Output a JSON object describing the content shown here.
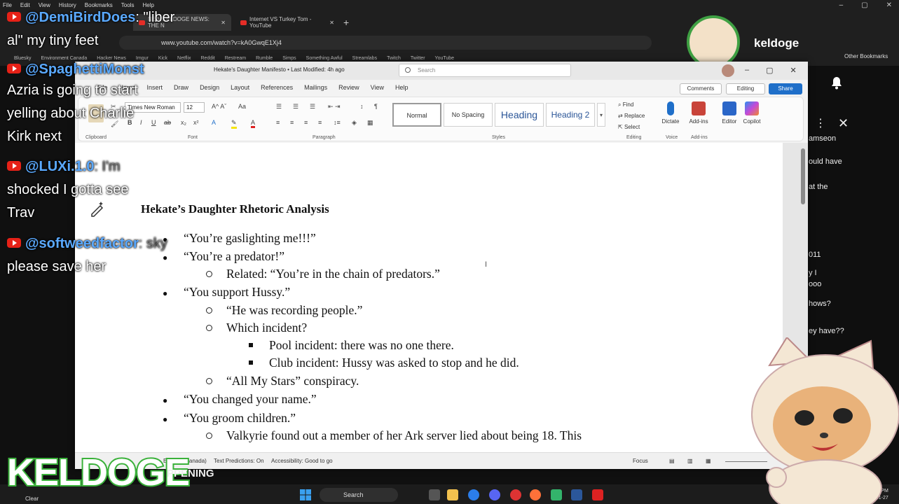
{
  "browser": {
    "menu": [
      "File",
      "Edit",
      "View",
      "History",
      "Bookmarks",
      "Tools",
      "Help"
    ],
    "tabs": [
      {
        "label": "NEW KELDOGE NEWS: THE N"
      },
      {
        "label": "Internet VS Turkey Tom - YouTube"
      }
    ],
    "new_tab": "+",
    "address": "www.youtube.com/watch?v=kA0GwqE1Xj4",
    "bookmarks": [
      "Bluesky",
      "Environment Canada",
      "Hacker News",
      "Imgur",
      "Kick",
      "Netflix",
      "Reddit",
      "Restream",
      "Rumble",
      "Simps",
      "Something Awful",
      "Streamlabs",
      "Twitch",
      "Twitter",
      "YouTube"
    ],
    "other_bookmarks": "Other Bookmarks"
  },
  "youtube": {
    "channel_name": "keldoge",
    "chat_snippets": [
      "amseon",
      "ould have",
      "at the",
      "011",
      "y I",
      "ooo",
      "hows?",
      "ey have??"
    ]
  },
  "word": {
    "doc_title": "Hekate's Daughter Manifesto • Last Modified: 4h ago",
    "search_placeholder": "Search",
    "ribbon_tabs": [
      "File",
      "Home",
      "Insert",
      "Draw",
      "Design",
      "Layout",
      "References",
      "Mailings",
      "Review",
      "View",
      "Help"
    ],
    "comments": "Comments",
    "editing": "Editing",
    "share": "Share",
    "font_name": "Times New Roman",
    "font_size": "12",
    "groups": {
      "clipboard": "Clipboard",
      "font": "Font",
      "paragraph": "Paragraph",
      "styles": "Styles",
      "editing": "Editing",
      "voice": "Voice",
      "addins": "Add-ins"
    },
    "styles": {
      "normal": "Normal",
      "no_spacing": "No Spacing",
      "heading1": "Heading",
      "heading2": "Heading 2"
    },
    "editing_tools": {
      "find": "Find",
      "replace": "Replace",
      "select": "Select"
    },
    "big_tools": {
      "dictate": "Dictate",
      "addins": "Add-ins",
      "editor": "Editor",
      "copilot": "Copilot"
    },
    "document": {
      "heading": "Hekate’s Daughter Rhetoric Analysis",
      "lines": [
        "“You’re gaslighting me!!!”",
        "“You’re a predator!”",
        "Related: “You’re in the chain of predators.”",
        "“You support Hussy.”",
        "“He was recording people.”",
        "Which incident?",
        "Pool incident: there was no one there.",
        "Club incident: Hussy was asked to stop and he did.",
        "“All My Stars” conspiracy.",
        "“You changed your name.”",
        "“You groom children.”",
        "Valkyrie found out a member of her Ark server lied about being 18. This"
      ]
    },
    "status": {
      "language": "English (Canada)",
      "predictions": "Text Predictions: On",
      "accessibility": "Accessibility: Good to go",
      "focus": "Focus"
    }
  },
  "chat_overlay": [
    {
      "name": "@DemiBirdDoes",
      "text": ": \"liber"
    },
    {
      "name": "",
      "text": "al\" my tiny feet"
    },
    {
      "name": "@SpaghettiMonst",
      "text": ""
    },
    {
      "name": "",
      "text": "Azria is going to start"
    },
    {
      "name": "",
      "text": "yelling about Charlie"
    },
    {
      "name": "",
      "text": "Kirk next"
    },
    {
      "name": "@LUXi.1.0",
      "text": ": I'm"
    },
    {
      "name": "",
      "text": "shocked I gotta see"
    },
    {
      "name": "",
      "text": "Trav"
    },
    {
      "name": "@softweedfactor",
      "text": ": sky"
    },
    {
      "name": "",
      "text": "please save her"
    }
  ],
  "stream": {
    "logo": "KELDOGE",
    "ticker": "PPENING"
  },
  "taskbar": {
    "weather": "Clear",
    "search": "Search",
    "time": "10:04 PM",
    "date": "2026-01-27"
  }
}
